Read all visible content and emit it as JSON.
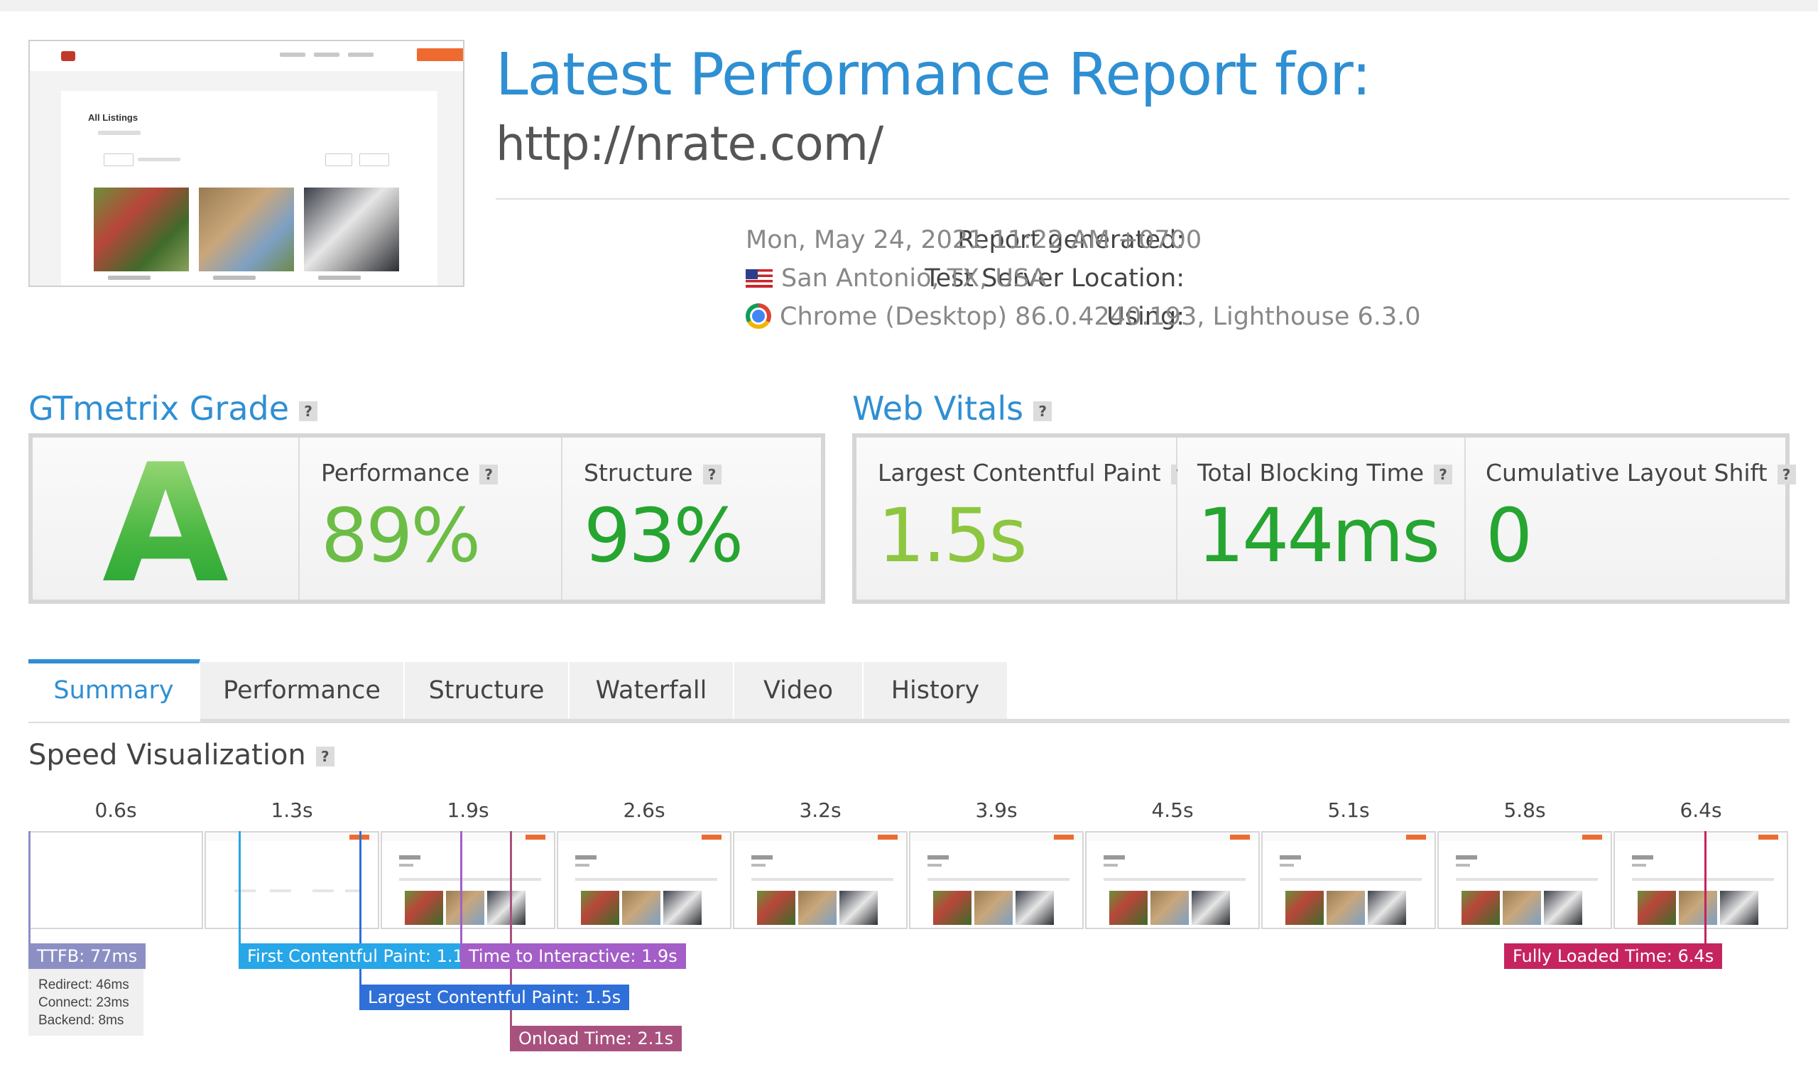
{
  "report": {
    "title": "Latest Performance Report for:",
    "url": "http://nrate.com/",
    "meta": [
      {
        "label": "Report generated",
        "value": "Mon, May 24, 2021 11:22 AM +0700",
        "icon": ""
      },
      {
        "label": "Test Server Location",
        "value": "San Antonio, TX, USA",
        "icon": "us-flag-icon"
      },
      {
        "label": "Using",
        "value": "Chrome (Desktop) 86.0.4240.193, Lighthouse 6.3.0",
        "icon": "chrome-icon"
      }
    ]
  },
  "thumbnail": {
    "page_title": "All Listings"
  },
  "grade": {
    "title": "GTmetrix Grade",
    "help": "?",
    "letter": "A",
    "performance": {
      "label": "Performance",
      "value": "89%",
      "color": "#6cbd45"
    },
    "structure": {
      "label": "Structure",
      "value": "93%",
      "color": "#26a531"
    }
  },
  "vitals": {
    "title": "Web Vitals",
    "help": "?",
    "lcp": {
      "label": "Largest Contentful Paint",
      "value": "1.5s",
      "color": "#8dc63f"
    },
    "tbt": {
      "label": "Total Blocking Time",
      "value": "144ms",
      "color": "#26a531"
    },
    "cls": {
      "label": "Cumulative Layout Shift",
      "value": "0",
      "color": "#26a531"
    }
  },
  "tabs": [
    {
      "label": "Summary",
      "active": true
    },
    {
      "label": "Performance",
      "active": false
    },
    {
      "label": "Structure",
      "active": false
    },
    {
      "label": "Waterfall",
      "active": false
    },
    {
      "label": "Video",
      "active": false
    },
    {
      "label": "History",
      "active": false
    }
  ],
  "speed": {
    "title": "Speed Visualization",
    "help": "?",
    "frames": [
      "0.6s",
      "1.3s",
      "1.9s",
      "2.6s",
      "3.2s",
      "3.9s",
      "4.5s",
      "5.1s",
      "5.8s",
      "6.4s"
    ],
    "markers": {
      "ttfb": {
        "label": "TTFB: 77ms",
        "color": "#8c8fc4"
      },
      "fcp": {
        "label": "First Contentful Paint: 1.1s",
        "color": "#27a6e8"
      },
      "lcp": {
        "label": "Largest Contentful Paint: 1.5s",
        "color": "#2f6fd8"
      },
      "tti": {
        "label": "Time to Interactive: 1.9s",
        "color": "#a45ec8"
      },
      "onload": {
        "label": "Onload Time: 2.1s",
        "color": "#a8517e"
      },
      "fully": {
        "label": "Fully Loaded Time: 6.4s",
        "color": "#c5245f"
      }
    },
    "ttfb_detail": [
      "Redirect: 46ms",
      "Connect: 23ms",
      "Backend: 8ms"
    ]
  },
  "colors": {
    "accent": "#2f8fd3"
  }
}
